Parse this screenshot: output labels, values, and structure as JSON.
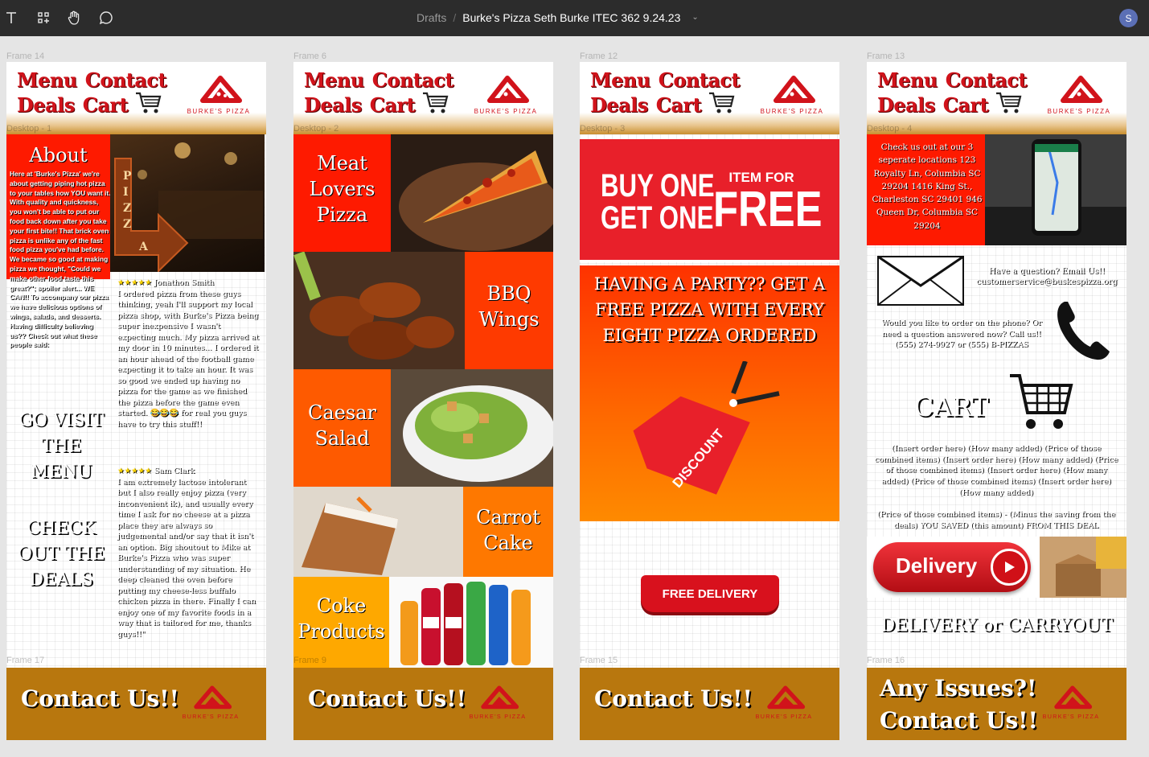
{
  "toolbar": {
    "breadcrumb_parent": "Drafts",
    "breadcrumb_sep": "/",
    "file_name": "Burke's Pizza Seth Burke ITEC 362 9.24.23",
    "avatar_initial": "S"
  },
  "labels": {
    "f1_outer": "Frame 14",
    "f1_inner": "Desktop - 1",
    "f1_bottom": "Frame 17",
    "f2_outer": "Frame 6",
    "f2_inner": "Desktop - 2",
    "f2_bottom": "Frame 9",
    "f3_outer": "Frame 12",
    "f3_inner": "Desktop - 3",
    "f3_bottom": "Frame 15",
    "f4_outer": "Frame 13",
    "f4_inner": "Desktop - 4",
    "f4_bottom": "Frame 16"
  },
  "header": {
    "menu": "Menu",
    "contact": "Contact",
    "deals": "Deals",
    "cart": "Cart",
    "logo_text": "BURKE'S PIZZA"
  },
  "footer": {
    "contact": "Contact Us!!",
    "issues": "Any Issues?!",
    "contact2": "Contact Us!!"
  },
  "about": {
    "title": "About",
    "body": "Here at 'Burke's Pizza' we're about getting piping hot pizza to your tables how YOU want it. With quality and quickness, you won't be able to put our food back down after you take your first bite!! That brick oven pizza is unlike any of the fast food pizza you've had before. We became so good at making pizza we thought, \"Could we make other food taste this great?\"; spoiler alert... WE CAN!! To accompany our pizza we have delicious options of wings, salads, and desserts. Having difficulty believing us?? Check out what these people said:",
    "sign_text": "PIZZA",
    "review1_stars": "★★★★★",
    "review1_name": "Jonathon Smith",
    "review1_text": "I ordered pizza from these guys thinking, yeah I'll support my local pizza shop, with Burke's Pizza being super inexpensive I wasn't expecting much. My pizza arrived at my door in 10 minutes... I ordered it an hour ahead of the football game expecting it to take an hour. It was so good we ended up having no pizza for the game as we finished the pizza before the game even started. 😂😂😂 for real you guys have to try this stuff!!",
    "review2_stars": "★★★★★",
    "review2_name": "Sam Clark",
    "review2_text": "I am extremely lactose intolerant but I also really enjoy pizza (very inconvenient ik), and usually every time I ask for no cheese at a pizza place they are always so judgemental and/or say that it isn't an option. Big shoutout to Mike at Burke's Pizza who was super understanding of my situation. He deep cleaned the oven before putting my cheese-less buffalo chicken pizza in there. Finally I can enjoy one of my favorite foods in a way that is tailored for me, thanks guys!!\"",
    "cta_menu": "GO VISIT THE MENU",
    "cta_deals": "CHECK OUT THE DEALS"
  },
  "menu": {
    "item1": "Meat Lovers Pizza",
    "item2": "BBQ Wings",
    "item3": "Caesar Salad",
    "item4": "Carrot Cake",
    "item5": "Coke Products"
  },
  "deals": {
    "bogo_line1": "BUY ONE",
    "bogo_line2": "GET ONE",
    "bogo_item_for": "ITEM FOR",
    "bogo_free": "FREE",
    "party": "HAVING A PARTY?? GET A FREE PIZZA WITH EVERY EIGHT PIZZA ORDERED",
    "tag": "DISCOUNT",
    "free_delivery": "FREE DELIVERY"
  },
  "cart": {
    "locations": "Check us out at our 3 seperate locations 123 Royalty Ln, Columbia SC 29204 1416 King St., Charleston SC 29401 946 Queen Dr, Columbia SC 29204",
    "email": "Have a question? Email Us!! customerservice@buskespizza.org",
    "phone": "Would you like to order on the phone? Or need a question answered now? Call us!! (555) 274-9927 or (555) B-PIZZAS",
    "cart_title": "CART",
    "order_lines": "(Insert order here) (How many added) (Price of those combined items) (Insert order here) (How many added) (Price of those combined items) (Insert order here) (How many added) (Price of those combined items) (Insert order here) (How many added)",
    "savings": "(Price of those combined items) - (Minus the saving from the deals) YOU SAVED (this amount) FROM THIS DEAL",
    "delivery_btn": "Delivery",
    "delivery_or": "DELIVERY or CARRYOUT"
  }
}
